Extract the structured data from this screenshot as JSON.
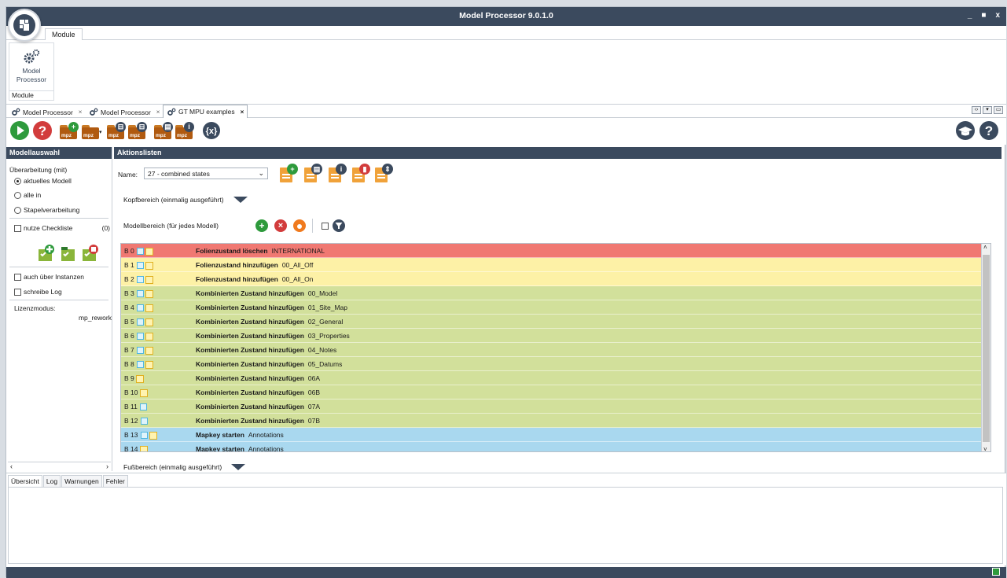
{
  "window": {
    "title": "Model Processor 9.0.1.0",
    "minimize": "_",
    "maximize": "■",
    "close": "x"
  },
  "ribbon": {
    "tab": "Module",
    "button_label": "Model Processor",
    "group_label": "Module"
  },
  "doc_tabs": [
    {
      "label": "Model Processor",
      "close": "×"
    },
    {
      "label": "Model Processor",
      "close": "×"
    },
    {
      "label": "GT MPU examples",
      "close": "×"
    }
  ],
  "toolbar": {
    "mpz": "mpz"
  },
  "left": {
    "header": "Modellauswahl",
    "processing_label": "Überarbeitung (mit)",
    "options": [
      "aktuelles Modell",
      "alle in",
      "Stapelverarbeitung"
    ],
    "checklist_label": "nutze Checkliste",
    "checklist_count": "(0)",
    "instances_label": "auch über Instanzen",
    "log_label": "schreibe Log",
    "license_label": "Lizenzmodus:",
    "license_value": "mp_rework"
  },
  "right": {
    "header": "Aktionslisten",
    "name_label": "Name:",
    "name_value": "27 - combined states",
    "head_section": "Kopfbereich (einmalig ausgeführt)",
    "model_section": "Modellbereich (für jedes Modell)",
    "foot_section": "Fußbereich (einmalig ausgeführt)"
  },
  "rows": [
    {
      "id": "B 0",
      "cmd": "Folienzustand löschen",
      "arg": "INTERNATIONAL",
      "color": "#f07872",
      "i1": true,
      "i2": true
    },
    {
      "id": "B 1",
      "cmd": "Folienzustand hinzufügen",
      "arg": "00_All_Off",
      "color": "#fdf1a6",
      "i1": true,
      "i2": true
    },
    {
      "id": "B 2",
      "cmd": "Folienzustand hinzufügen",
      "arg": "00_All_On",
      "color": "#fdf1a6",
      "i1": true,
      "i2": true
    },
    {
      "id": "B 3",
      "cmd": "Kombinierten Zustand hinzufügen",
      "arg": "00_Model",
      "color": "#d2e09b",
      "i1": true,
      "i2": true
    },
    {
      "id": "B 4",
      "cmd": "Kombinierten Zustand hinzufügen",
      "arg": "01_Site_Map",
      "color": "#d2e09b",
      "i1": true,
      "i2": true
    },
    {
      "id": "B 5",
      "cmd": "Kombinierten Zustand hinzufügen",
      "arg": "02_General",
      "color": "#d2e09b",
      "i1": true,
      "i2": true
    },
    {
      "id": "B 6",
      "cmd": "Kombinierten Zustand hinzufügen",
      "arg": "03_Properties",
      "color": "#d2e09b",
      "i1": true,
      "i2": true
    },
    {
      "id": "B 7",
      "cmd": "Kombinierten Zustand hinzufügen",
      "arg": "04_Notes",
      "color": "#d2e09b",
      "i1": true,
      "i2": true
    },
    {
      "id": "B 8",
      "cmd": "Kombinierten Zustand hinzufügen",
      "arg": "05_Datums",
      "color": "#d2e09b",
      "i1": true,
      "i2": true
    },
    {
      "id": "B 9",
      "cmd": "Kombinierten Zustand hinzufügen",
      "arg": "06A",
      "color": "#d2e09b",
      "i1": false,
      "i2": true
    },
    {
      "id": "B 10",
      "cmd": "Kombinierten Zustand hinzufügen",
      "arg": "06B",
      "color": "#d2e09b",
      "i1": false,
      "i2": true
    },
    {
      "id": "B 11",
      "cmd": "Kombinierten Zustand hinzufügen",
      "arg": "07A",
      "color": "#d2e09b",
      "i1": true,
      "i2": false
    },
    {
      "id": "B 12",
      "cmd": "Kombinierten Zustand hinzufügen",
      "arg": "07B",
      "color": "#d2e09b",
      "i1": true,
      "i2": false
    },
    {
      "id": "B 13",
      "cmd": "Mapkey starten",
      "arg": "Annotations",
      "color": "#a9d8ef",
      "i1": true,
      "i2": true
    },
    {
      "id": "B 14",
      "cmd": "Mapkey starten",
      "arg": "Annotations",
      "color": "#a9d8ef",
      "i1": false,
      "i2": true
    }
  ],
  "bottom_tabs": [
    "Übersicht",
    "Log",
    "Warnungen",
    "Fehler"
  ],
  "colors": {
    "accent": "#3b4a5e",
    "green": "#2e9a3c",
    "red": "#d23c3c",
    "orange": "#f0a23a"
  }
}
